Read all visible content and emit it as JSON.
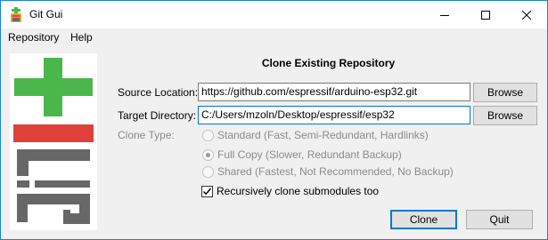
{
  "window": {
    "title": "Git Gui"
  },
  "menu": [
    "Repository",
    "Help"
  ],
  "dialog": {
    "heading": "Clone Existing Repository",
    "source_label": "Source Location:",
    "source_value": "https://github.com/espressif/arduino-esp32.git",
    "target_label": "Target Directory:",
    "target_value": "C:/Users/mzoln/Desktop/espressif/esp32",
    "browse_label": "Browse",
    "clone_type_label": "Clone Type:",
    "clone_types": [
      {
        "label": "Standard (Fast, Semi-Redundant, Hardlinks)",
        "selected": false
      },
      {
        "label": "Full Copy (Slower, Redundant Backup)",
        "selected": true
      },
      {
        "label": "Shared (Fastest, Not Recommended, No Backup)",
        "selected": false
      }
    ],
    "recursive_label": "Recursively clone submodules too",
    "recursive_checked": true,
    "clone_button": "Clone",
    "quit_button": "Quit"
  },
  "colors": {
    "logo_green": "#4bb74a",
    "logo_red": "#e0403a",
    "logo_gray": "#676767",
    "accent": "#0078d7"
  }
}
